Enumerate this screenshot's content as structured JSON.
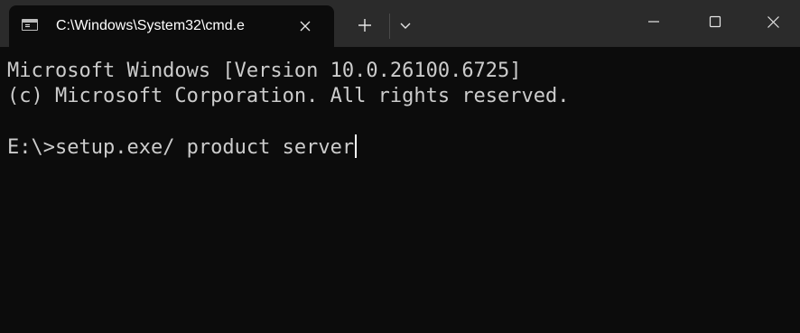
{
  "window": {
    "tab": {
      "title": "C:\\Windows\\System32\\cmd.e",
      "icon": "cmd-console-icon",
      "close_icon": "close-icon"
    },
    "controls": {
      "new_tab_icon": "plus-icon",
      "dropdown_icon": "chevron-down-icon",
      "minimize_icon": "minimize-icon",
      "maximize_icon": "maximize-icon",
      "close_icon": "close-icon"
    }
  },
  "console": {
    "lines": [
      "Microsoft Windows [Version 10.0.26100.6725]",
      "(c) Microsoft Corporation. All rights reserved."
    ],
    "prompt": "E:\\>",
    "command": "setup.exe/ product server"
  },
  "colors": {
    "titlebar": "#2b2b2b",
    "background": "#0c0c0c",
    "text": "#cccccc"
  }
}
